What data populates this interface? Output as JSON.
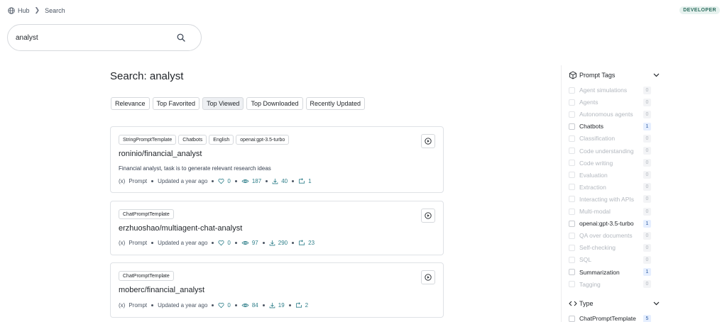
{
  "breadcrumb": {
    "home": "Hub",
    "current": "Search"
  },
  "badge": "DEVELOPER",
  "search": {
    "value": "analyst"
  },
  "page_title": "Search: analyst",
  "sort_tabs": [
    {
      "label": "Relevance",
      "active": false
    },
    {
      "label": "Top Favorited",
      "active": false
    },
    {
      "label": "Top Viewed",
      "active": true
    },
    {
      "label": "Top Downloaded",
      "active": false
    },
    {
      "label": "Recently Updated",
      "active": false
    }
  ],
  "results": [
    {
      "tags": [
        "StringPromptTemplate",
        "Chatbots",
        "English",
        "openai:gpt-3.5-turbo"
      ],
      "title": "roninio/financial_analyst",
      "description": "Financial analyst, task is to generate relevant research ideas",
      "kind": "Prompt",
      "updated": "Updated a year ago",
      "likes": "0",
      "views": "187",
      "downloads": "40",
      "forks": "1"
    },
    {
      "tags": [
        "ChatPromptTemplate"
      ],
      "title": "erzhuoshao/multiagent-chat-analyst",
      "description": "",
      "kind": "Prompt",
      "updated": "Updated a year ago",
      "likes": "0",
      "views": "97",
      "downloads": "290",
      "forks": "23"
    },
    {
      "tags": [
        "ChatPromptTemplate"
      ],
      "title": "moberc/financial_analyst",
      "description": "",
      "kind": "Prompt",
      "updated": "Updated a year ago",
      "likes": "0",
      "views": "84",
      "downloads": "19",
      "forks": "2"
    }
  ],
  "sidebar": {
    "prompt_tags_title": "Prompt Tags",
    "prompt_tags": [
      {
        "label": "Agent simulations",
        "count": "0",
        "enabled": false
      },
      {
        "label": "Agents",
        "count": "0",
        "enabled": false
      },
      {
        "label": "Autonomous agents",
        "count": "0",
        "enabled": false
      },
      {
        "label": "Chatbots",
        "count": "1",
        "enabled": true
      },
      {
        "label": "Classification",
        "count": "0",
        "enabled": false
      },
      {
        "label": "Code understanding",
        "count": "0",
        "enabled": false
      },
      {
        "label": "Code writing",
        "count": "0",
        "enabled": false
      },
      {
        "label": "Evaluation",
        "count": "0",
        "enabled": false
      },
      {
        "label": "Extraction",
        "count": "0",
        "enabled": false
      },
      {
        "label": "Interacting with APIs",
        "count": "0",
        "enabled": false
      },
      {
        "label": "Multi-modal",
        "count": "0",
        "enabled": false
      },
      {
        "label": "openai:gpt-3.5-turbo",
        "count": "1",
        "enabled": true
      },
      {
        "label": "QA over documents",
        "count": "0",
        "enabled": false
      },
      {
        "label": "Self-checking",
        "count": "0",
        "enabled": false
      },
      {
        "label": "SQL",
        "count": "0",
        "enabled": false
      },
      {
        "label": "Summarization",
        "count": "1",
        "enabled": true
      },
      {
        "label": "Tagging",
        "count": "0",
        "enabled": false
      }
    ],
    "type_title": "Type",
    "types": [
      {
        "label": "ChatPromptTemplate",
        "count": "5",
        "enabled": true
      }
    ]
  }
}
